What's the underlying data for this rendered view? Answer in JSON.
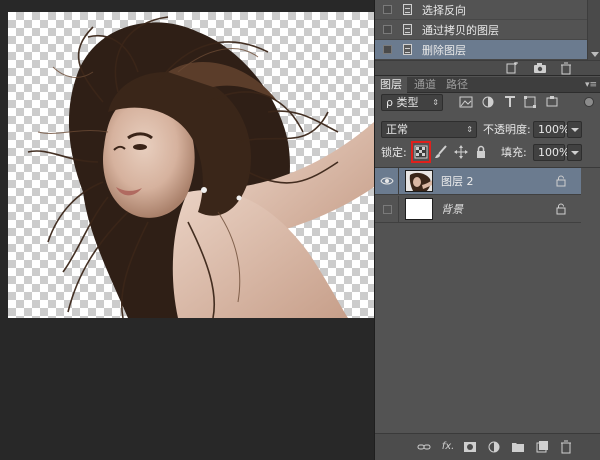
{
  "history": {
    "items": [
      {
        "label": "选择反向",
        "active": false
      },
      {
        "label": "通过拷贝的图层",
        "active": false
      },
      {
        "label": "删除图层",
        "active": true
      }
    ]
  },
  "layers_panel": {
    "tabs": [
      {
        "label": "图层",
        "active": true
      },
      {
        "label": "通道",
        "active": false
      },
      {
        "label": "路径",
        "active": false
      }
    ],
    "filter": {
      "label": "ρ 类型"
    },
    "blend_mode": "正常",
    "opacity_label": "不透明度:",
    "opacity_value": "100%",
    "lock_label": "锁定:",
    "fill_label": "填充:",
    "fill_value": "100%",
    "layers": [
      {
        "name": "图层 2",
        "selected": true,
        "visible": true,
        "locked": true
      },
      {
        "name": "背景",
        "selected": false,
        "visible": false,
        "locked": true
      }
    ],
    "footer_icons": [
      "link-icon",
      "fx-icon",
      "mask-icon",
      "adjustment-icon",
      "group-icon",
      "new-layer-icon",
      "delete-icon"
    ]
  },
  "colors": {
    "panel_bg": "#535353",
    "selection_bg": "#6b7b8f",
    "workspace_bg": "#282828",
    "highlight_red": "#e0201c"
  }
}
